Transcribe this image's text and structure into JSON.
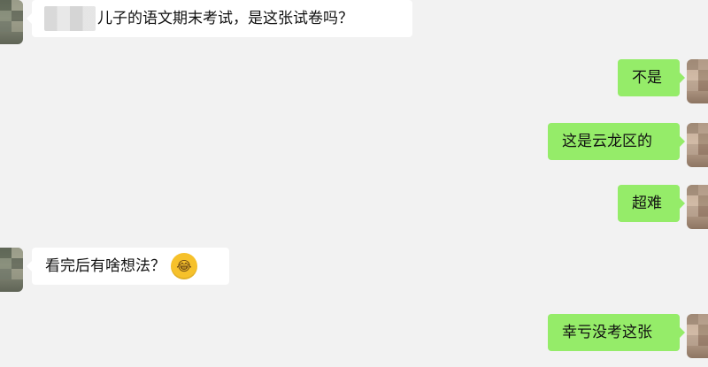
{
  "messages": [
    {
      "side": "left",
      "text": "儿子的语文期末考试，是这张试卷吗？",
      "has_blurred_name": true
    },
    {
      "side": "right",
      "text": "不是"
    },
    {
      "side": "right",
      "text": "这是云龙区的"
    },
    {
      "side": "right",
      "text": "超难"
    },
    {
      "side": "left",
      "text": "看完后有啥想法？",
      "emoji": "😂"
    },
    {
      "side": "right",
      "text": "幸亏没考这张"
    }
  ],
  "colors": {
    "background": "#f2f2f2",
    "incoming_bubble": "#ffffff",
    "outgoing_bubble": "#95ec69"
  },
  "icons": {
    "left_avatar": "blurred-avatar-icon",
    "right_avatar": "blurred-avatar-icon",
    "emoji": "laughing-crying-emoji-icon"
  }
}
